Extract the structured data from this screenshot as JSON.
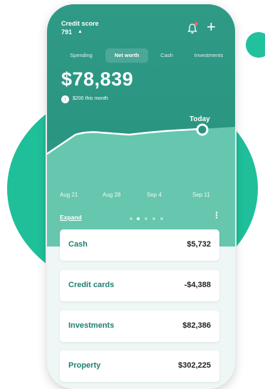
{
  "header": {
    "credit_score_label": "Credit score",
    "credit_score_value": "791",
    "credit_score_trend": "▲"
  },
  "tabs": [
    {
      "label": "Spending",
      "active": false
    },
    {
      "label": "Net worth",
      "active": true
    },
    {
      "label": "Cash",
      "active": false
    },
    {
      "label": "Investments",
      "active": false
    }
  ],
  "net_worth": {
    "value": "$78,839",
    "change_text": "$200 this month",
    "change_icon": "arrow-up-icon"
  },
  "chart": {
    "today_label": "Today",
    "x_labels": [
      "Aug 21",
      "Aug 28",
      "Sep 4",
      "Sep 11"
    ]
  },
  "controls": {
    "expand_label": "Expand",
    "page_count": 5,
    "active_page": 2,
    "more_icon": "more-vertical-icon"
  },
  "accounts": [
    {
      "label": "Cash",
      "value": "$5,732"
    },
    {
      "label": "Credit cards",
      "value": "-$4,388"
    },
    {
      "label": "Investments",
      "value": "$82,386"
    },
    {
      "label": "Property",
      "value": "$302,225"
    }
  ],
  "colors": {
    "brand_teal": "#2a9581",
    "accent_green": "#1fbf9a",
    "notification_dot": "#ff5a78",
    "label_teal": "#1d7f70"
  }
}
